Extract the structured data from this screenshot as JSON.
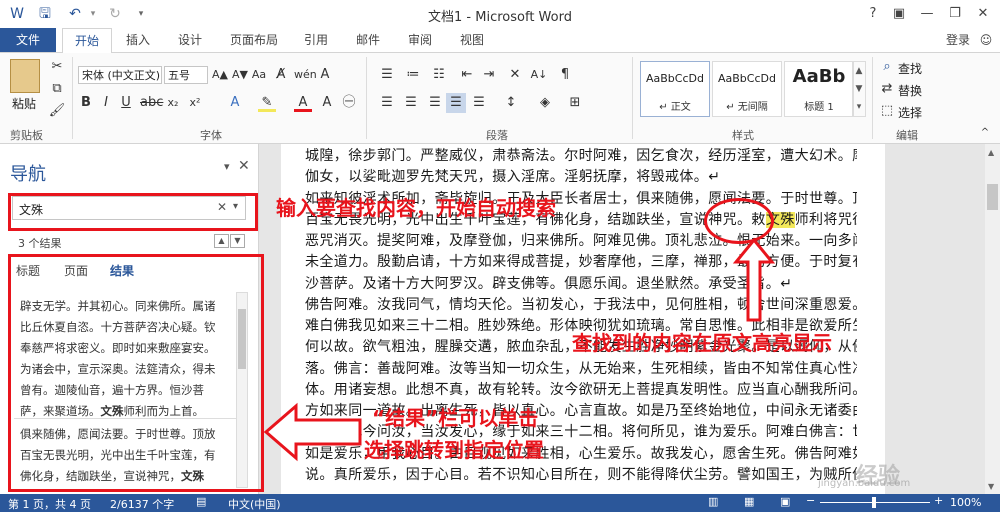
{
  "window": {
    "title": "文档1 - Microsoft Word",
    "help": "?",
    "login": "登录"
  },
  "tabs": [
    "文件",
    "开始",
    "插入",
    "设计",
    "页面布局",
    "引用",
    "邮件",
    "审阅",
    "视图"
  ],
  "ribbon": {
    "paste_label": "粘贴",
    "font_name": "宋体 (中文正文)",
    "font_size": "五号",
    "group_clipboard": "剪贴板",
    "group_font": "字体",
    "group_paragraph": "段落",
    "group_styles": "样式",
    "group_editing": "编辑",
    "styles": [
      {
        "preview": "AaBbCcDd",
        "name": "↵ 正文"
      },
      {
        "preview": "AaBbCcDd",
        "name": "↵ 无间隔"
      },
      {
        "preview": "AaBb",
        "name": "标题 1"
      }
    ],
    "find_label": "查找",
    "replace_label": "替换",
    "select_label": "选择"
  },
  "nav": {
    "title": "导航",
    "search_value": "文殊",
    "results_count": "3 个结果",
    "tabs": [
      "标题",
      "页面",
      "结果"
    ],
    "result1_lines": [
      "辟支无学。并其初心。同来佛所。属诸",
      "比丘休夏自恣。十方菩萨咨决心疑。钦",
      "奉慈严将求密义。即时如来敷座宴安。",
      "为诸会中，宣示深奥。法筵清众，得未",
      "曾有。迦陵仙音，遍十方界。恒沙菩",
      "萨，来聚道场。"
    ],
    "result1_end": "师利而为上首。",
    "result2_lines": [
      "俱来随佛，愿闻法要。于时世尊。顶放",
      "百宝无畏光明，光中出生千叶宝莲，有",
      "佛化身，结跏趺坐，宣说神咒，"
    ]
  },
  "document": {
    "lines": [
      "城隍，徐步郭门。严整威仪，肃恭斋法。尔时阿难，因乞食次，经历淫室，遭大幻术。摩登",
      "伽女，以娑毗迦罗先梵天咒，摄入淫席。淫躬抚摩，将毁戒体。↵",
      "如来知彼淫术所加，斋毕旋归。王及大臣长者居士，俱来随佛，愿闻法要。于时世尊。顶放",
      "百宝无畏光明，光中出生千叶宝莲，有佛化身，结跏趺坐，宣说神咒。敕",
      "恶咒消灭。提奖阿难，及摩登伽，归来佛所。阿难见佛。顶礼悲泣。恨无始来。一向多闻，",
      "未全道力。殷勤启请，十方如来得成菩提，妙奢摩他，三摩，禅那，最初方便。于时复有恒",
      "沙菩萨。及诸十方大阿罗汉。辟支佛等。俱愿乐闻。退坐默然。承受圣旨。↵",
      "佛告阿难。汝我同气，情均天伦。当初发心，于我法中，见何胜相，顿舍世间深重恩爱。阿",
      "难白佛我见如来三十二相。胜妙殊绝。形体映彻犹如琉璃。常自思惟。此相非是欲爱所生。",
      "何以故。欲气粗浊，腥臊交遘，脓血杂乱，不能发生胜净妙明紫金光聚。是以渴仰，从佛剃",
      "落。佛言：善哉阿难。汝等当知一切众生，从无始来，生死相续，皆由不知常住真心性净明",
      "体。用诸妄想。此想不真，故有轮转。汝今欲研无上菩提真发明性。应当直心酬我所问。十",
      "方如来同一道故。出离生死，皆以直心。心言直故。如是乃至终始地位，中间永无诸委曲相。",
      "阿难。我今问汝，当汝发心，缘于如来三十二相。将何所见，谁为爱乐。阿难白佛言：世尊。",
      "如是爱乐，用我心目。由目观见如来胜相，心生爱乐。故我发心，愿舍生死。佛告阿难如汝所",
      "说。真所爱乐，因于心目。若不识知心目所在，则不能得降伏尘劳。譬如国王，为贼所侵，"
    ],
    "highlight_before": "百宝无畏光明，光中出生千叶宝莲，有佛化身，结跏趺坐，宣说神咒。敕",
    "highlight_word": "文殊",
    "highlight_after": "师利将咒往护。"
  },
  "annotations": {
    "search_tip": "输入要查找内容，开始自动搜索",
    "highlight_tip": "查找到的内容在原文高亮显示",
    "result_tip_1": "“结果”栏可以单击",
    "result_tip_2": "选择跳转到指定位置",
    "accent_color": "#e8141c"
  },
  "status": {
    "page": "第 1 页，共 4 页",
    "words": "2/6137 个字",
    "language": "中文(中国)",
    "zoom": "100%"
  },
  "watermark": {
    "text": "经验",
    "url": "jingyan.baidu.com"
  },
  "colors": {
    "word_blue": "#2b579a",
    "highlight": "#f3e85a"
  }
}
